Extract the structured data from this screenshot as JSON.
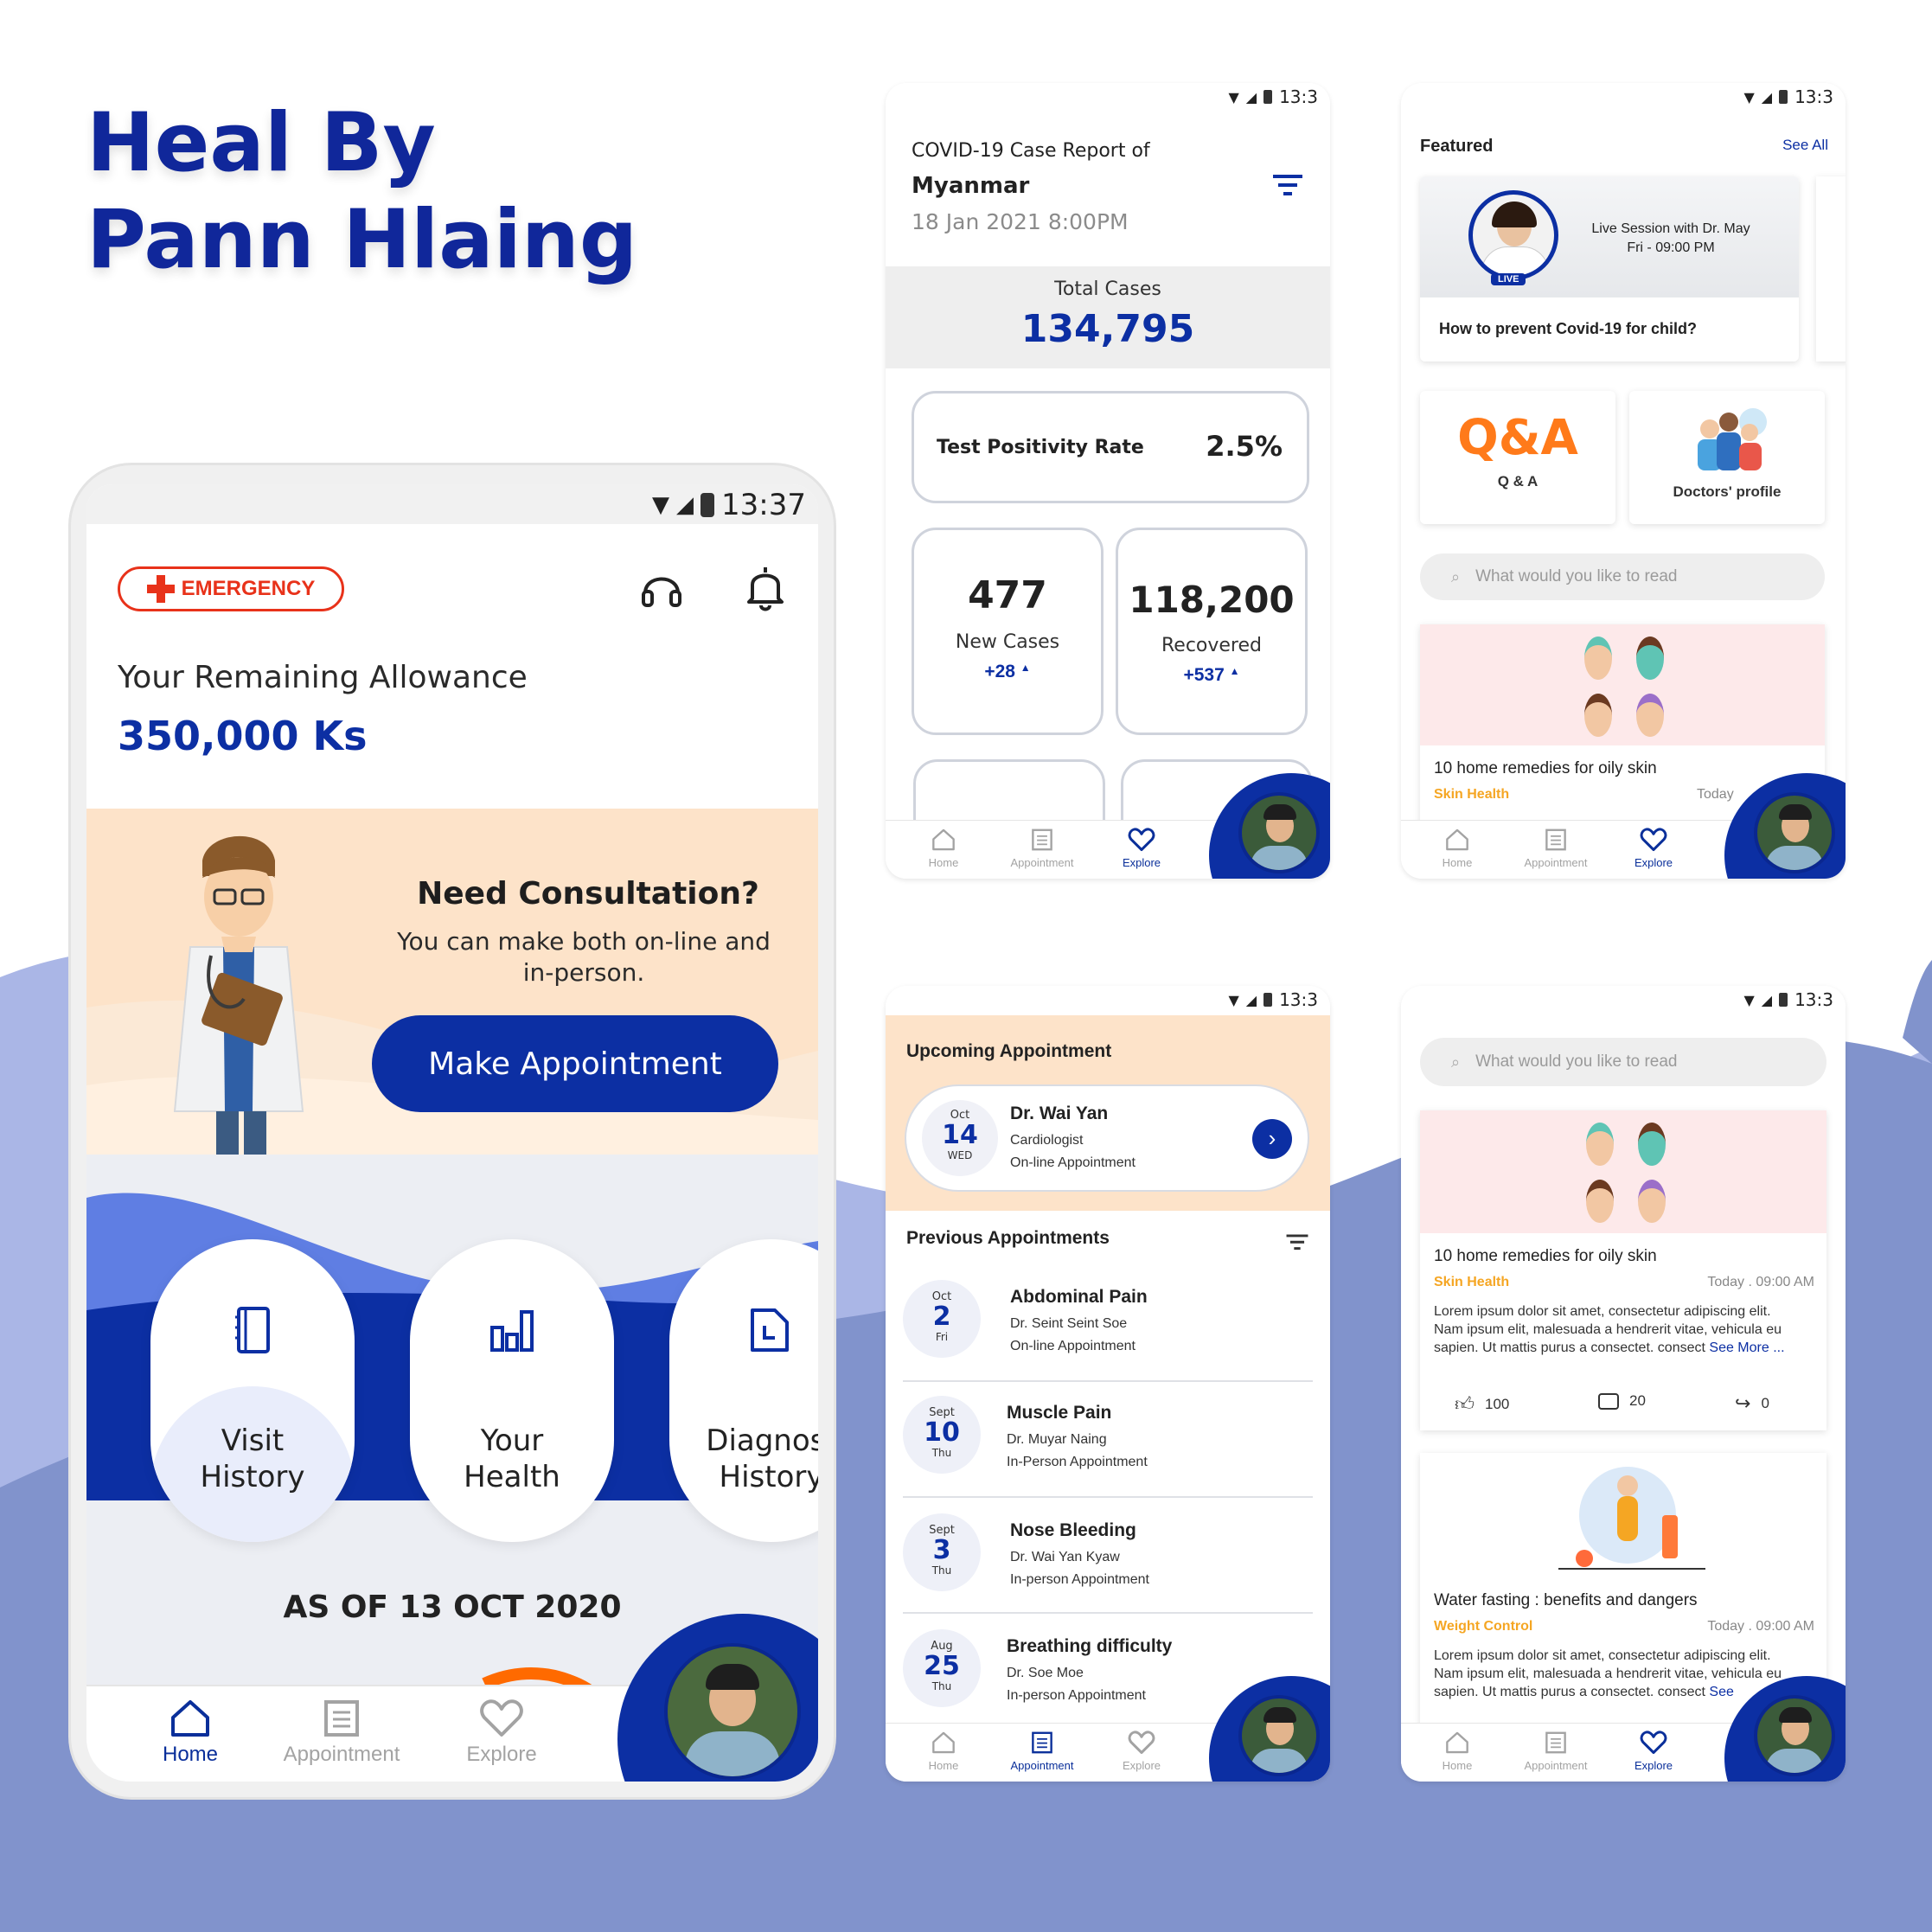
{
  "title": {
    "line1": "Heal By",
    "line2": "Pann Hlaing"
  },
  "colors": {
    "primary": "#0c2fa3",
    "accent": "#f5a623",
    "emergency": "#e8321a",
    "background_wave": "#8193cc"
  },
  "main_phone": {
    "status_time": "13:37",
    "emergency_label": "EMERGENCY",
    "allowance_label": "Your Remaining Allowance",
    "allowance_value": "350,000 Ks",
    "consult_title": "Need Consultation?",
    "consult_text_1": "You can make both on-line and",
    "consult_text_2": "in-person.",
    "make_appointment": "Make Appointment",
    "quick": [
      {
        "line1": "Visit",
        "line2": "History",
        "icon": "notebook-icon"
      },
      {
        "line1": "Your",
        "line2": "Health",
        "icon": "bar-chart-icon"
      },
      {
        "line1": "Diagnost",
        "line2": "History",
        "icon": "document-icon"
      }
    ],
    "as_of": "AS OF 13 OCT 2020",
    "nav": [
      "Home",
      "Appointment",
      "Explore"
    ]
  },
  "covid_phone": {
    "status_time": "13:3",
    "report_title": "COVID-19 Case Report of",
    "country": "Myanmar",
    "date": "18 Jan 2021 8:00PM",
    "total_label": "Total Cases",
    "total_value": "134,795",
    "positivity_label": "Test Positivity Rate",
    "positivity_value": "2.5%",
    "new_cases_value": "477",
    "new_cases_label": "New Cases",
    "new_cases_delta": "+28",
    "recovered_value": "118,200",
    "recovered_label": "Recovered",
    "recovered_delta": "+537",
    "nav": [
      "Home",
      "Appointment",
      "Explore"
    ]
  },
  "featured_phone": {
    "status_time": "13:3",
    "featured_label": "Featured",
    "see_all": "See All",
    "live_badge": "LIVE",
    "live_line1": "Live Session with Dr. May",
    "live_line2": "Fri - 09:00 PM",
    "feature_title": "How to prevent Covid-19 for child?",
    "qa_art": "Q&A",
    "qa_label": "Q & A",
    "doctors_label": "Doctors' profile",
    "search_placeholder": "What would you like to read",
    "article_title": "10 home remedies for oily skin",
    "article_tag": "Skin Health",
    "article_time": "Today",
    "nav": [
      "Home",
      "Appointment",
      "Explore"
    ]
  },
  "appointment_phone": {
    "status_time": "13:3",
    "upcoming_label": "Upcoming Appointment",
    "upcoming": {
      "month": "Oct",
      "day": "14",
      "weekday": "WED",
      "doctor": "Dr. Wai Yan",
      "specialty": "Cardiologist",
      "type": "On-line Appointment"
    },
    "previous_label": "Previous Appointments",
    "previous": [
      {
        "month": "Oct",
        "day": "2",
        "weekday": "Fri",
        "title": "Abdominal Pain",
        "doctor": "Dr. Seint Seint Soe",
        "type": "On-line Appointment"
      },
      {
        "month": "Sept",
        "day": "10",
        "weekday": "Thu",
        "title": "Muscle Pain",
        "doctor": "Dr. Muyar Naing",
        "type": "In-Person Appointment"
      },
      {
        "month": "Sept",
        "day": "3",
        "weekday": "Thu",
        "title": "Nose Bleeding",
        "doctor": "Dr. Wai Yan Kyaw",
        "type": "In-person Appointment"
      },
      {
        "month": "Aug",
        "day": "25",
        "weekday": "Thu",
        "title": "Breathing difficulty",
        "doctor": "Dr. Soe Moe",
        "type": "In-person Appointment"
      }
    ],
    "nav": [
      "Home",
      "Appointment",
      "Explore"
    ]
  },
  "articles_phone": {
    "status_time": "13:3",
    "search_placeholder": "What would you like to read",
    "articles": [
      {
        "title": "10 home remedies for oily skin",
        "tag": "Skin Health",
        "time": "Today . 09:00 AM",
        "text_1": "Lorem ipsum dolor sit amet, consectetur adipiscing elit.",
        "text_2": "Nam ipsum elit, malesuada a hendrerit vitae, vehicula eu",
        "text_3": "sapien. Ut mattis purus a consectet. consect",
        "see_more": "See More ...",
        "likes": "100",
        "comments": "20",
        "shares": "0"
      },
      {
        "title": "Water fasting : benefits and dangers",
        "tag": "Weight Control",
        "time": "Today . 09:00 AM",
        "text_1": "Lorem ipsum dolor sit amet, consectetur adipiscing elit.",
        "text_2": "Nam ipsum elit, malesuada a hendrerit vitae, vehicula eu",
        "text_3": "sapien. Ut mattis purus a consectet. consect",
        "see_more": "See"
      }
    ],
    "nav": [
      "Home",
      "Appointment",
      "Explore"
    ]
  }
}
